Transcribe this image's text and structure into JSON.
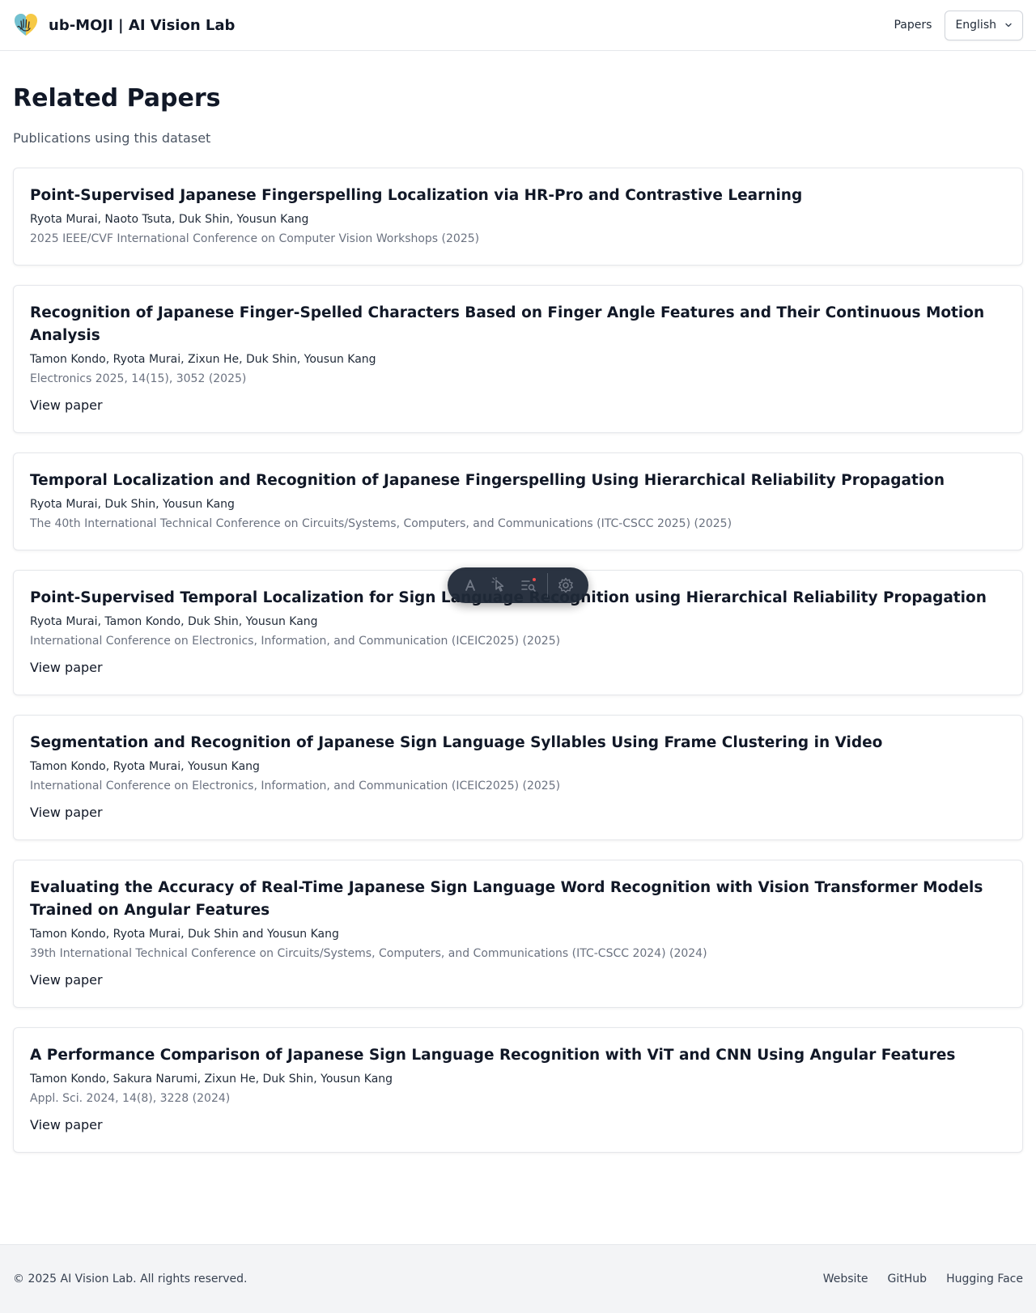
{
  "header": {
    "brand_name": "ub-MOJI | AI Vision Lab",
    "logo_icon": "hand-heart-logo",
    "nav_papers": "Papers",
    "language": "English"
  },
  "main": {
    "title": "Related Papers",
    "subtitle": "Publications using this dataset",
    "papers": [
      {
        "title": "Point-Supervised Japanese Fingerspelling Localization via HR-Pro and Contrastive Learning",
        "authors": "Ryota Murai, Naoto Tsuta, Duk Shin, Yousun Kang",
        "venue": "2025 IEEE/CVF International Conference on Computer Vision Workshops (2025)"
      },
      {
        "title": "Recognition of Japanese Finger-Spelled Characters Based on Finger Angle Features and Their Continuous Motion Analysis",
        "authors": "Tamon Kondo, Ryota Murai, Zixun He, Duk Shin, Yousun Kang",
        "venue": "Electronics 2025, 14(15), 3052 (2025)",
        "link_label": "View paper"
      },
      {
        "title": "Temporal Localization and Recognition of Japanese Fingerspelling Using Hierarchical Reliability Propagation",
        "authors": "Ryota Murai, Duk Shin, Yousun Kang",
        "venue": "The 40th International Technical Conference on Circuits/Systems, Computers, and Communications (ITC-CSCC 2025) (2025)"
      },
      {
        "title": "Point-Supervised Temporal Localization for Sign Language Recognition using Hierarchical Reliability Propagation",
        "authors": "Ryota Murai, Tamon Kondo, Duk Shin, Yousun Kang",
        "venue": "International Conference on Electronics, Information, and Communication (ICEIC2025) (2025)",
        "link_label": "View paper"
      },
      {
        "title": "Segmentation and Recognition of Japanese Sign Language Syllables Using Frame Clustering in Video",
        "authors": "Tamon Kondo, Ryota Murai, Yousun Kang",
        "venue": "International Conference on Electronics, Information, and Communication (ICEIC2025) (2025)",
        "link_label": "View paper"
      },
      {
        "title": "Evaluating the Accuracy of Real-Time Japanese Sign Language Word Recognition with Vision Transformer Models Trained on Angular Features",
        "authors": "Tamon Kondo, Ryota Murai, Duk Shin and Yousun Kang",
        "venue": "39th International Technical Conference on Circuits/Systems, Computers, and Communications (ITC-CSCC 2024) (2024)",
        "link_label": "View paper"
      },
      {
        "title": "A Performance Comparison of Japanese Sign Language Recognition with ViT and CNN Using Angular Features",
        "authors": "Tamon Kondo, Sakura Narumi, Zixun He, Duk Shin, Yousun Kang",
        "venue": "Appl. Sci. 2024, 14(8), 3228 (2024)",
        "link_label": "View paper"
      }
    ]
  },
  "toolbar": {
    "icons": [
      "text-tool-icon",
      "cursor-select-icon",
      "list-search-icon",
      "gear-icon"
    ]
  },
  "footer": {
    "copyright": "© 2025 AI Vision Lab. All rights reserved.",
    "links": [
      "Website",
      "GitHub",
      "Hugging Face"
    ]
  }
}
